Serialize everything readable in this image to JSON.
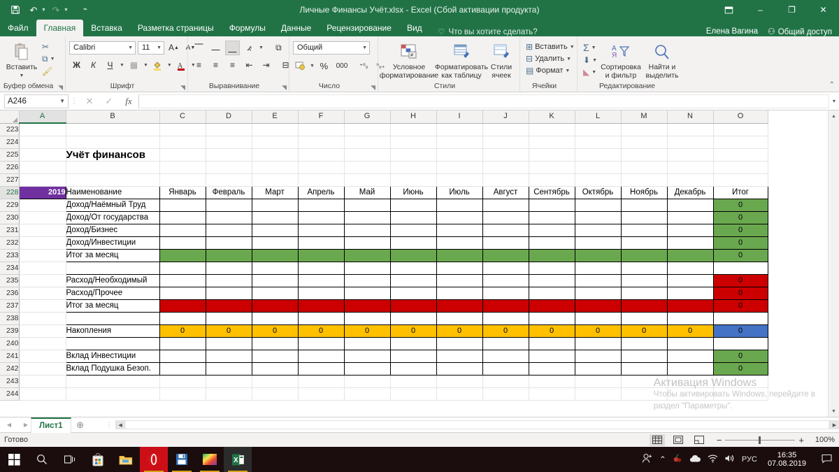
{
  "titlebar": {
    "title": "Личные Финансы Учёт.xlsx - Excel (Сбой активации продукта)",
    "save_icon": "save-icon",
    "undo_icon": "undo-icon",
    "redo_icon": "redo-icon",
    "customize_icon": "customize-qat-icon",
    "minimize": "–",
    "restore": "❐",
    "close": "✕",
    "ribbon_display": "⊡"
  },
  "ribbon": {
    "tabs": [
      {
        "label": "Файл",
        "active": false
      },
      {
        "label": "Главная",
        "active": true
      },
      {
        "label": "Вставка",
        "active": false
      },
      {
        "label": "Разметка страницы",
        "active": false
      },
      {
        "label": "Формулы",
        "active": false
      },
      {
        "label": "Данные",
        "active": false
      },
      {
        "label": "Рецензирование",
        "active": false
      },
      {
        "label": "Вид",
        "active": false
      }
    ],
    "tellme": "Что вы хотите сделать?",
    "user": "Елена Вагина",
    "share": "Общий доступ",
    "groups": {
      "clipboard": {
        "label": "Буфер обмена",
        "paste": "Вставить",
        "cut": "Вырезать",
        "copy": "Копировать",
        "format_painter": "Формат по образцу"
      },
      "font": {
        "label": "Шрифт",
        "font_name": "Calibri",
        "font_size": "11",
        "grow": "A",
        "shrink": "A",
        "bold": "Ж",
        "italic": "К",
        "underline": "Ч",
        "borders": "Границы",
        "fill": "Цвет заливки",
        "color": "Цвет текста"
      },
      "alignment": {
        "label": "Выравнивание",
        "orientation": "Ориентация",
        "wrap": "Перенести текст",
        "merge": "Объединить и поместить в центре"
      },
      "number": {
        "label": "Число",
        "format": "Общий",
        "currency": "Финансовый формат",
        "percent": "%",
        "thousands": "000",
        "inc_dec": "Увеличить разрядность",
        "dec_dec": "Уменьшить разрядность"
      },
      "styles": {
        "label": "Стили",
        "conditional": "Условное\nформатирование",
        "conditional_l1": "Условное",
        "conditional_l2": "форматирование",
        "as_table_l1": "Форматировать",
        "as_table_l2": "как таблицу",
        "cell_styles_l1": "Стили",
        "cell_styles_l2": "ячеек"
      },
      "cells": {
        "label": "Ячейки",
        "insert": "Вставить",
        "delete": "Удалить",
        "format": "Формат"
      },
      "editing": {
        "label": "Редактирование",
        "autosum": "Σ",
        "fill": "Заполнить",
        "clear": "Очистить",
        "sort_l1": "Сортировка",
        "sort_l2": "и фильтр",
        "find_l1": "Найти и",
        "find_l2": "выделить",
        "collapse": "Свернуть ленту"
      }
    }
  },
  "formulabar": {
    "namebox": "A246",
    "cancel": "✕",
    "enter": "✓",
    "fx": "fx",
    "value": "",
    "expand": "▾"
  },
  "grid": {
    "columns": [
      "A",
      "B",
      "C",
      "D",
      "E",
      "F",
      "G",
      "H",
      "I",
      "J",
      "K",
      "L",
      "M",
      "N",
      "O"
    ],
    "selected_column": "A",
    "rows": [
      223,
      224,
      225,
      226,
      227,
      228,
      229,
      230,
      231,
      232,
      233,
      234,
      235,
      236,
      237,
      238,
      239,
      240,
      241,
      242,
      243,
      244
    ],
    "title_cell": {
      "row": 225,
      "col": "B",
      "text": "Учёт финансов"
    },
    "year_badge": "2019",
    "header_label": "Наименование",
    "months": [
      "Январь",
      "Февраль",
      "Март",
      "Апрель",
      "Май",
      "Июнь",
      "Июль",
      "Август",
      "Сентябрь",
      "Октябрь",
      "Ноябрь",
      "Декабрь"
    ],
    "total_header": "Итог",
    "data_rows": [
      {
        "row": 229,
        "label": "Доход/Наёмный Труд",
        "months": [
          "",
          "",
          "",
          "",
          "",
          "",
          "",
          "",
          "",
          "",
          "",
          ""
        ],
        "total": "0",
        "month_fill": "none",
        "total_fill": "green"
      },
      {
        "row": 230,
        "label": "Доход/От государства",
        "months": [
          "",
          "",
          "",
          "",
          "",
          "",
          "",
          "",
          "",
          "",
          "",
          ""
        ],
        "total": "0",
        "month_fill": "none",
        "total_fill": "green"
      },
      {
        "row": 231,
        "label": "Доход/Бизнес",
        "months": [
          "",
          "",
          "",
          "",
          "",
          "",
          "",
          "",
          "",
          "",
          "",
          ""
        ],
        "total": "0",
        "month_fill": "none",
        "total_fill": "green"
      },
      {
        "row": 232,
        "label": "Доход/Инвестиции",
        "months": [
          "",
          "",
          "",
          "",
          "",
          "",
          "",
          "",
          "",
          "",
          "",
          ""
        ],
        "total": "0",
        "month_fill": "none",
        "total_fill": "green"
      },
      {
        "row": 233,
        "label": "Итог за месяц",
        "months": [
          "",
          "",
          "",
          "",
          "",
          "",
          "",
          "",
          "",
          "",
          "",
          ""
        ],
        "total": "0",
        "month_fill": "green",
        "total_fill": "green"
      },
      {
        "row": 234,
        "label": "",
        "months": [
          "",
          "",
          "",
          "",
          "",
          "",
          "",
          "",
          "",
          "",
          "",
          ""
        ],
        "total": "",
        "month_fill": "none",
        "total_fill": "none"
      },
      {
        "row": 235,
        "label": "Расход/Необходимый",
        "months": [
          "",
          "",
          "",
          "",
          "",
          "",
          "",
          "",
          "",
          "",
          "",
          ""
        ],
        "total": "0",
        "month_fill": "none",
        "total_fill": "red"
      },
      {
        "row": 236,
        "label": "Расход/Прочее",
        "months": [
          "",
          "",
          "",
          "",
          "",
          "",
          "",
          "",
          "",
          "",
          "",
          ""
        ],
        "total": "0",
        "month_fill": "none",
        "total_fill": "red"
      },
      {
        "row": 237,
        "label": "Итог за месяц",
        "months": [
          "",
          "",
          "",
          "",
          "",
          "",
          "",
          "",
          "",
          "",
          "",
          ""
        ],
        "total": "0",
        "month_fill": "red",
        "total_fill": "red"
      },
      {
        "row": 238,
        "label": "",
        "months": [
          "",
          "",
          "",
          "",
          "",
          "",
          "",
          "",
          "",
          "",
          "",
          ""
        ],
        "total": "",
        "month_fill": "none",
        "total_fill": "none"
      },
      {
        "row": 239,
        "label": "Накопления",
        "months": [
          "0",
          "0",
          "0",
          "0",
          "0",
          "0",
          "0",
          "0",
          "0",
          "0",
          "0",
          "0"
        ],
        "total": "0",
        "month_fill": "yellow",
        "total_fill": "blue"
      },
      {
        "row": 240,
        "label": "",
        "months": [
          "",
          "",
          "",
          "",
          "",
          "",
          "",
          "",
          "",
          "",
          "",
          ""
        ],
        "total": "",
        "month_fill": "none",
        "total_fill": "none"
      },
      {
        "row": 241,
        "label": "Вклад Инвестиции",
        "months": [
          "",
          "",
          "",
          "",
          "",
          "",
          "",
          "",
          "",
          "",
          "",
          ""
        ],
        "total": "0",
        "month_fill": "none",
        "total_fill": "green"
      },
      {
        "row": 242,
        "label": "Вклад Подушка Безоп.",
        "months": [
          "",
          "",
          "",
          "",
          "",
          "",
          "",
          "",
          "",
          "",
          "",
          ""
        ],
        "total": "0",
        "month_fill": "none",
        "total_fill": "green"
      }
    ],
    "colors": {
      "green": "#6aa84f",
      "red": "#cc0000",
      "yellow": "#ffc000",
      "blue": "#4472c4",
      "purple": "#7030a0"
    }
  },
  "watermark": {
    "line1": "Активация Windows",
    "line2": "Чтобы активировать Windows, перейдите в",
    "line3": "раздел \"Параметры\"."
  },
  "sheettabs": {
    "prev": "◀",
    "next": "▶",
    "tabs": [
      {
        "label": "Лист1",
        "active": true
      }
    ],
    "add": "⊕"
  },
  "statusbar": {
    "status": "Готово",
    "view_normal": "normal-view-icon",
    "view_layout": "page-layout-icon",
    "view_pagebreak": "page-break-icon",
    "zoom_out": "−",
    "zoom_in": "+",
    "zoom": "100%"
  },
  "taskbar": {
    "items": [
      {
        "name": "start-button",
        "glyph": "⊞"
      },
      {
        "name": "search-button",
        "glyph": "◯"
      },
      {
        "name": "task-view-button",
        "glyph": "❐"
      },
      {
        "name": "microsoft-store",
        "glyph": "▣"
      },
      {
        "name": "file-explorer",
        "glyph": "▤"
      },
      {
        "name": "opera-browser",
        "glyph": "O"
      },
      {
        "name": "save-app",
        "glyph": "▣"
      },
      {
        "name": "gradient-app",
        "glyph": "▦"
      },
      {
        "name": "excel-app",
        "glyph": "X"
      }
    ],
    "tray": {
      "people": "people-icon",
      "show_hidden": "⌃",
      "app1": "red-tray-icon",
      "cloud": "cloud-icon",
      "wifi": "wifi-icon",
      "volume": "volume-icon",
      "language": "РУС"
    },
    "clock": {
      "time": "16:35",
      "date": "07.08.2019"
    },
    "notifications": "notification-icon"
  }
}
